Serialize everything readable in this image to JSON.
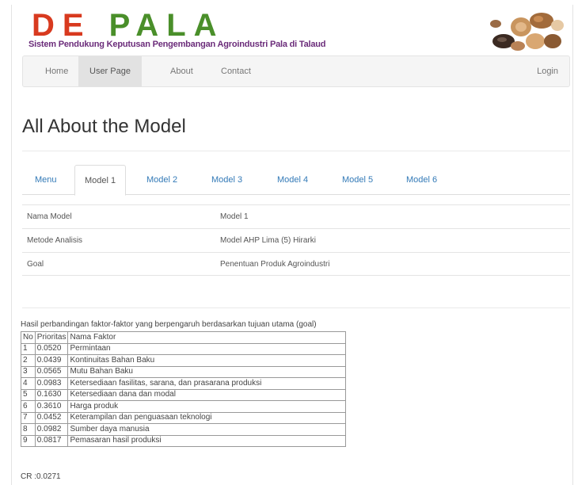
{
  "header": {
    "brand_letters": [
      "D",
      "E",
      "P",
      "A",
      "L",
      "A"
    ],
    "subtitle": "Sistem Pendukung Keputusan Pengembangan Agroindustri Pala di Talaud"
  },
  "navbar": {
    "items": [
      {
        "label": "Home"
      },
      {
        "label": "User Page"
      },
      {
        "label": "About"
      },
      {
        "label": "Contact"
      }
    ],
    "login": "Login"
  },
  "page": {
    "title": "All About the Model"
  },
  "tabs": [
    {
      "label": "Menu"
    },
    {
      "label": "Model 1"
    },
    {
      "label": "Model 2"
    },
    {
      "label": "Model 3"
    },
    {
      "label": "Model 4"
    },
    {
      "label": "Model 5"
    },
    {
      "label": "Model 6"
    }
  ],
  "info": [
    {
      "key": "Nama Model",
      "value": "Model 1"
    },
    {
      "key": "Metode Analisis",
      "value": "Model AHP Lima (5) Hirarki"
    },
    {
      "key": "Goal",
      "value": "Penentuan Produk Agroindustri"
    }
  ],
  "factors": {
    "caption": "Hasil perbandingan faktor-faktor yang berpengaruh berdasarkan tujuan utama (goal)",
    "headers": [
      "No",
      "Prioritas",
      "Nama Faktor"
    ],
    "rows": [
      {
        "no": "1",
        "prioritas": "0.0520",
        "nama": "Permintaan"
      },
      {
        "no": "2",
        "prioritas": "0.0439",
        "nama": "Kontinuitas Bahan Baku"
      },
      {
        "no": "3",
        "prioritas": "0.0565",
        "nama": "Mutu Bahan Baku"
      },
      {
        "no": "4",
        "prioritas": "0.0983",
        "nama": "Ketersediaan fasilitas, sarana, dan prasarana produksi"
      },
      {
        "no": "5",
        "prioritas": "0.1630",
        "nama": "Ketersediaan dana dan modal"
      },
      {
        "no": "6",
        "prioritas": "0.3610",
        "nama": "Harga produk"
      },
      {
        "no": "7",
        "prioritas": "0.0452",
        "nama": "Keterampilan dan penguasaan teknologi"
      },
      {
        "no": "8",
        "prioritas": "0.0982",
        "nama": "Sumber daya manusia"
      },
      {
        "no": "9",
        "prioritas": "0.0817",
        "nama": "Pemasaran hasil produksi"
      }
    ],
    "cr_label": "CR :0.0271"
  },
  "colors": {
    "brand_red": "#d83a1f",
    "brand_green": "#4a8f2a",
    "subtitle_purple": "#6b2c7a",
    "link_blue": "#337ab7"
  }
}
